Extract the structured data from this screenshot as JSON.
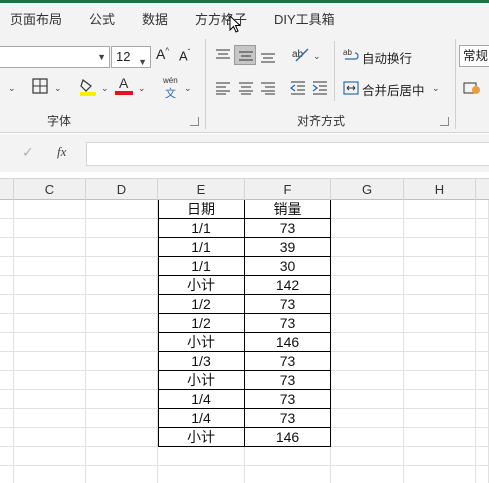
{
  "tabs": [
    "页面布局",
    "公式",
    "数据",
    "方方格子",
    "DIY工具箱"
  ],
  "ribbon": {
    "font_size": "12",
    "font_group_label": "字体",
    "align_group_label": "对齐方式",
    "wrap_text_label": "自动换行",
    "merge_center_label": "合并后居中",
    "number_format": "常规",
    "phonetic_glyph_top": "wén",
    "phonetic_glyph_bottom": "文",
    "font_color": "#e81123",
    "fill_color": "#ffee00"
  },
  "formula_bar": {
    "fx_label": "fx",
    "content": ""
  },
  "columns": [
    "C",
    "D",
    "E",
    "F",
    "G",
    "H"
  ],
  "table": {
    "headers": [
      "日期",
      "销量"
    ],
    "rows": [
      [
        "1/1",
        "73"
      ],
      [
        "1/1",
        "39"
      ],
      [
        "1/1",
        "30"
      ],
      [
        "小计",
        "142"
      ],
      [
        "1/2",
        "73"
      ],
      [
        "1/2",
        "73"
      ],
      [
        "小计",
        "146"
      ],
      [
        "1/3",
        "73"
      ],
      [
        "小计",
        "73"
      ],
      [
        "1/4",
        "73"
      ],
      [
        "1/4",
        "73"
      ],
      [
        "小计",
        "146"
      ]
    ]
  },
  "colors": {
    "accent": "#1e7145",
    "ribbon_bg": "#f3f3f3"
  }
}
